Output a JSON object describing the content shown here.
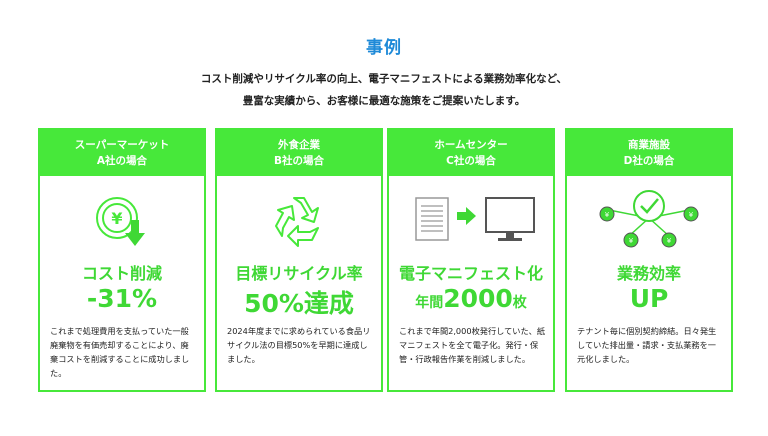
{
  "section_title": "事例",
  "intro_lines": [
    "コスト削減やリサイクル率の向上、電子マニフェストによる業務効率化など、",
    "豊富な実績から、お客様に最適な施策をご提案いたします。"
  ],
  "colors": {
    "accent": "#47e83a",
    "title": "#1f8ad8"
  },
  "cards": [
    {
      "head_line1": "スーパーマーケット",
      "head_line2": "A社の場合",
      "icon": "yen-down-icon",
      "metric": "コスト削減",
      "value": "-31%",
      "desc": "これまで処理費用を支払っていた一般廃棄物を有価売却することにより、廃棄コストを削減することに成功しました。"
    },
    {
      "head_line1": "外食企業",
      "head_line2": "B社の場合",
      "icon": "recycle-icon",
      "metric": "目標リサイクル率",
      "value": "50%達成",
      "desc": "2024年度までに求められている食品リサイクル法の目標50%を早期に達成しました。"
    },
    {
      "head_line1": "ホームセンター",
      "head_line2": "C社の場合",
      "icon": "paper-to-computer-icon",
      "metric": "電子マニフェスト化",
      "value_prefix": "年間",
      "value_number": "2000",
      "value_suffix": "枚",
      "desc": "これまで年間2,000枚発行していた、紙マニフェストを全て電子化。発行・保管・行政報告作業を削減しました。"
    },
    {
      "head_line1": "商業施設",
      "head_line2": "D社の場合",
      "icon": "network-check-icon",
      "metric": "業務効率",
      "value": "UP",
      "desc": "テナント毎に個別契約締結。日々発生していた排出量・請求・支払業務を一元化しました。"
    }
  ]
}
